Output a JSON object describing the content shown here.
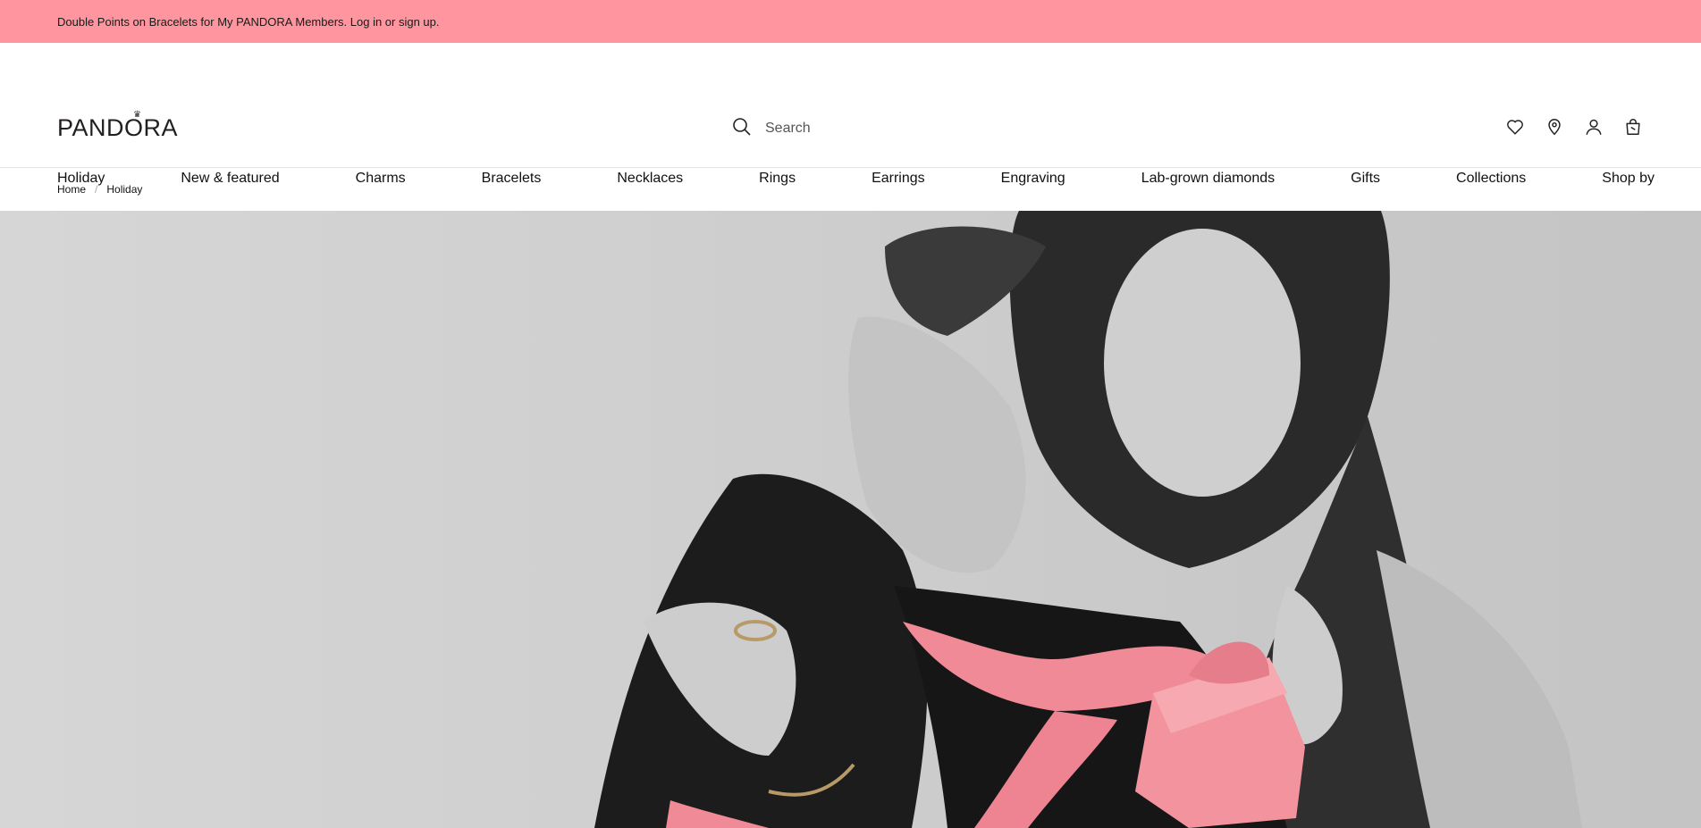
{
  "promo": {
    "text": "Double Points on Bracelets for My PANDORA Members. Log in or sign up."
  },
  "header": {
    "logo_text": "PANDORA",
    "search": {
      "placeholder": "Search",
      "icon": "search-icon"
    },
    "icons": [
      {
        "name": "heart-icon",
        "label": "Wishlist"
      },
      {
        "name": "location-pin-icon",
        "label": "Store locator"
      },
      {
        "name": "user-icon",
        "label": "Account"
      },
      {
        "name": "shopping-bag-icon",
        "label": "Bag"
      }
    ]
  },
  "nav": {
    "items": [
      {
        "label": "Holiday"
      },
      {
        "label": "New & featured"
      },
      {
        "label": "Charms"
      },
      {
        "label": "Bracelets"
      },
      {
        "label": "Necklaces"
      },
      {
        "label": "Rings"
      },
      {
        "label": "Earrings"
      },
      {
        "label": "Engraving"
      },
      {
        "label": "Lab-grown diamonds"
      },
      {
        "label": "Gifts"
      },
      {
        "label": "Collections"
      },
      {
        "label": "Shop by"
      }
    ]
  },
  "breadcrumb": {
    "items": [
      "Home",
      "Holiday"
    ],
    "separator": "/"
  },
  "hero": {
    "image_description": "black-and-white photo of a couple embracing with a pink gift box and pink ribbon",
    "accent_color": "#f08a96",
    "background_color": "#cfcfcf"
  },
  "colors": {
    "promo_bg": "#ff959e",
    "text": "#111111"
  }
}
